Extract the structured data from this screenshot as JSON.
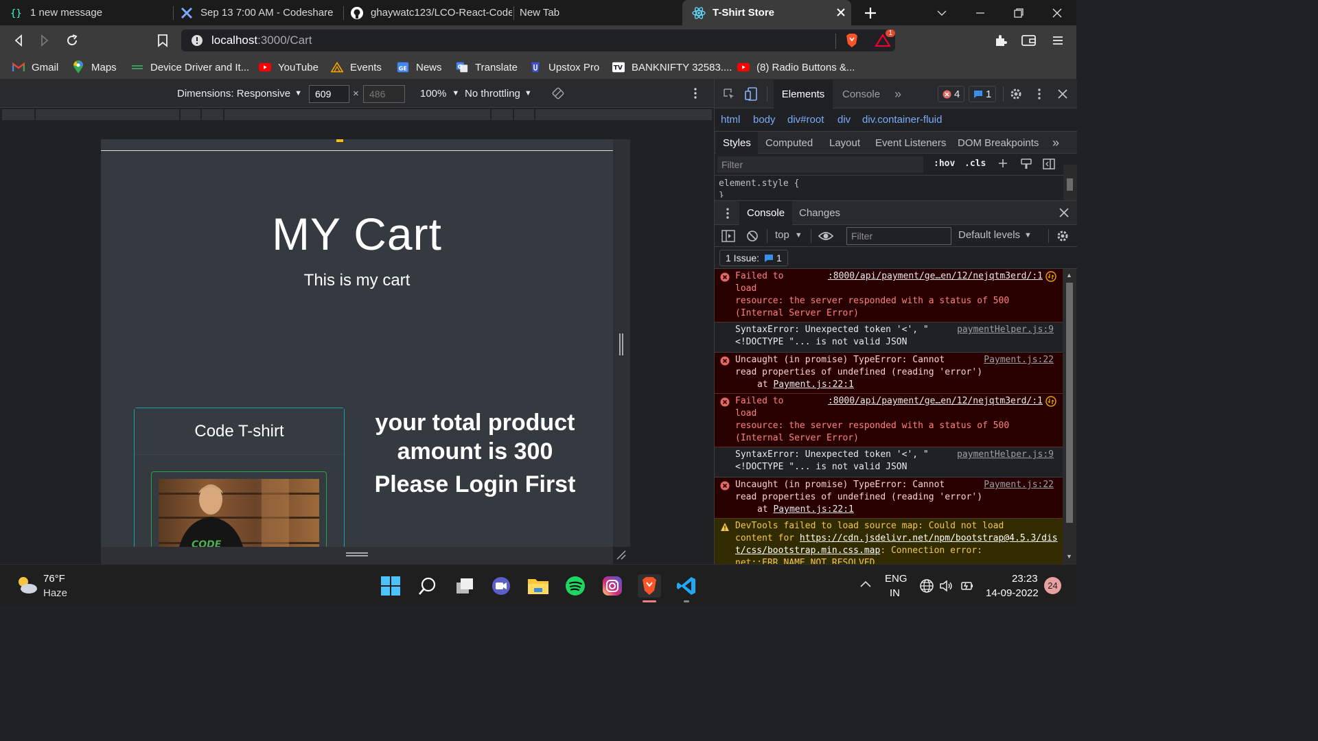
{
  "browser": {
    "tabs": [
      {
        "title": "1 new message",
        "icon": "message-icon"
      },
      {
        "title": "Sep 13 7:00 AM - Codeshare",
        "icon": "codeshare-icon"
      },
      {
        "title": "ghaywatc123/LCO-React-Code",
        "icon": "github-icon"
      },
      {
        "title": "New Tab",
        "icon": ""
      },
      {
        "title": "T-Shirt Store",
        "icon": "react-icon",
        "active": true
      }
    ],
    "url_host": "localhost",
    "url_path": ":3000/Cart",
    "brave_badge": "1",
    "bookmarks": [
      {
        "label": "Gmail",
        "icon": "gmail-icon"
      },
      {
        "label": "Maps",
        "icon": "maps-icon"
      },
      {
        "label": "Device Driver and It...",
        "icon": "device-driver-icon"
      },
      {
        "label": "YouTube",
        "icon": "youtube-icon"
      },
      {
        "label": "Events",
        "icon": "events-icon"
      },
      {
        "label": "News",
        "icon": "news-icon"
      },
      {
        "label": "Translate",
        "icon": "translate-icon"
      },
      {
        "label": "Upstox Pro",
        "icon": "upstox-icon"
      },
      {
        "label": "BANKNIFTY 32583....",
        "icon": "tradingview-icon"
      },
      {
        "label": "(8) Radio Buttons &...",
        "icon": "youtube-icon"
      }
    ]
  },
  "device_toolbar": {
    "dimensions": "Dimensions: Responsive",
    "width": "609",
    "height": "486",
    "times": "×",
    "zoom": "100%",
    "throttling": "No throttling"
  },
  "page": {
    "title": "MY Cart",
    "subtitle": "This is my cart",
    "card_title": "Code T-shirt",
    "total_text": "your total product amount is 300",
    "login_text": "Please Login First"
  },
  "devtools": {
    "tabs": [
      "Elements",
      "Console"
    ],
    "error_count": "4",
    "issue_count": "1",
    "breadcrumbs": [
      "html",
      "body",
      "div#root",
      "div",
      "div.container-fluid"
    ],
    "style_tabs": [
      "Styles",
      "Computed",
      "Layout",
      "Event Listeners",
      "DOM Breakpoints"
    ],
    "filter_placeholder": "Filter",
    "hov": ":hov",
    "cls": ".cls",
    "element_style": "element.style {",
    "element_style_close": "}",
    "drawer_tabs": [
      "Console",
      "Changes"
    ],
    "context": "top",
    "console_filter_placeholder": "Filter",
    "levels": "Default levels",
    "issues_label": "1 Issue:",
    "issues_count": "1",
    "messages": [
      {
        "type": "err",
        "text": "Failed to\nload\nresource: the server responded with a status of 500\n(Internal Server Error)",
        "src": ":8000/api/payment/ge…en/12/nejqtm3erd/:1"
      },
      {
        "type": "plain",
        "text": "SyntaxError: Unexpected token '<', \"\n<!DOCTYPE \"... is not valid JSON",
        "src": "paymentHelper.js:9"
      },
      {
        "type": "err",
        "text": "Uncaught (in promise) TypeError: Cannot\nread properties of undefined (reading 'error')",
        "at": "at ",
        "atlink": "Payment.js:22:1",
        "src": "Payment.js:22"
      },
      {
        "type": "err",
        "text": "Failed to\nload\nresource: the server responded with a status of 500\n(Internal Server Error)",
        "src": ":8000/api/payment/ge…en/12/nejqtm3erd/:1"
      },
      {
        "type": "plain",
        "text": "SyntaxError: Unexpected token '<', \"\n<!DOCTYPE \"... is not valid JSON",
        "src": "paymentHelper.js:9"
      },
      {
        "type": "err",
        "text": "Uncaught (in promise) TypeError: Cannot\nread properties of undefined (reading 'error')",
        "at": "at ",
        "atlink": "Payment.js:22:1",
        "src": "Payment.js:22"
      },
      {
        "type": "warn",
        "text": "DevTools failed to load source map: Could not load\ncontent for ",
        "link": "https://cdn.jsdelivr.net/npm/bootstrap@4.5.3/dist/css/bootstrap.min.css.map",
        "tail": ": Connection error:\nnet::ERR_NAME_NOT_RESOLVED"
      }
    ]
  },
  "taskbar": {
    "weather_temp": "76°F",
    "weather_desc": "Haze",
    "lang": "ENG",
    "region": "IN",
    "time": "23:23",
    "date": "14-09-2022",
    "notifications": "24"
  },
  "colors": {
    "page_bg": "#343a40",
    "card_border": "#17a2b8",
    "img_border": "#28a745",
    "error_bg": "#290000",
    "warn_bg": "#332b00"
  }
}
